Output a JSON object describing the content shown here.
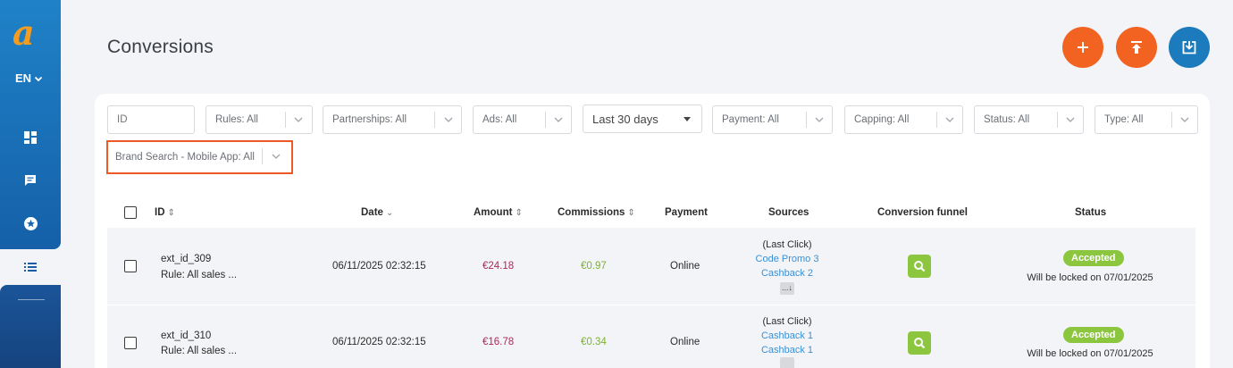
{
  "sidebar": {
    "logo": "a",
    "language": "EN",
    "icons": [
      "dashboard-icon",
      "message-icon",
      "star-icon",
      "list-icon"
    ]
  },
  "header": {
    "title": "Conversions",
    "actions": [
      "add-icon",
      "upload-icon",
      "download-icon"
    ]
  },
  "filters": {
    "id_placeholder": "ID",
    "rules": "Rules: All",
    "partnerships": "Partnerships: All",
    "ads": "Ads: All",
    "date_range": "Last 30 days",
    "payment": "Payment: All",
    "capping": "Capping: All",
    "status": "Status: All",
    "type": "Type: All",
    "brand_search": "Brand Search - Mobile App: All"
  },
  "table": {
    "columns": {
      "id": "ID",
      "date": "Date",
      "amount": "Amount",
      "commissions": "Commissions",
      "payment": "Payment",
      "sources": "Sources",
      "funnel": "Conversion funnel",
      "status": "Status"
    },
    "rows": [
      {
        "id": "ext_id_309",
        "rule": "Rule: All sales ...",
        "date": "06/11/2025 02:32:15",
        "amount": "€24.18",
        "commission": "€0.97",
        "payment": "Online",
        "source_head": "(Last Click)",
        "source_1": "Code Promo 3",
        "source_2": "Cashback 2",
        "more": "...↓",
        "status": "Accepted",
        "locked": "Will be locked on 07/01/2025"
      },
      {
        "id": "ext_id_310",
        "rule": "Rule: All sales ...",
        "date": "06/11/2025 02:32:15",
        "amount": "€16.78",
        "commission": "€0.34",
        "payment": "Online",
        "source_head": "(Last Click)",
        "source_1": "Cashback 1",
        "source_2": "Cashback 1",
        "status": "Accepted",
        "locked": "Will be locked on 07/01/2025"
      }
    ]
  },
  "colors": {
    "accent_orange": "#f26322",
    "accent_blue": "#1b7bbd",
    "status_green": "#8cc63f",
    "amount_red": "#b3275a",
    "commission_green": "#7cb32a",
    "link_blue": "#3d8fd1",
    "highlight": "#ee5a24"
  }
}
